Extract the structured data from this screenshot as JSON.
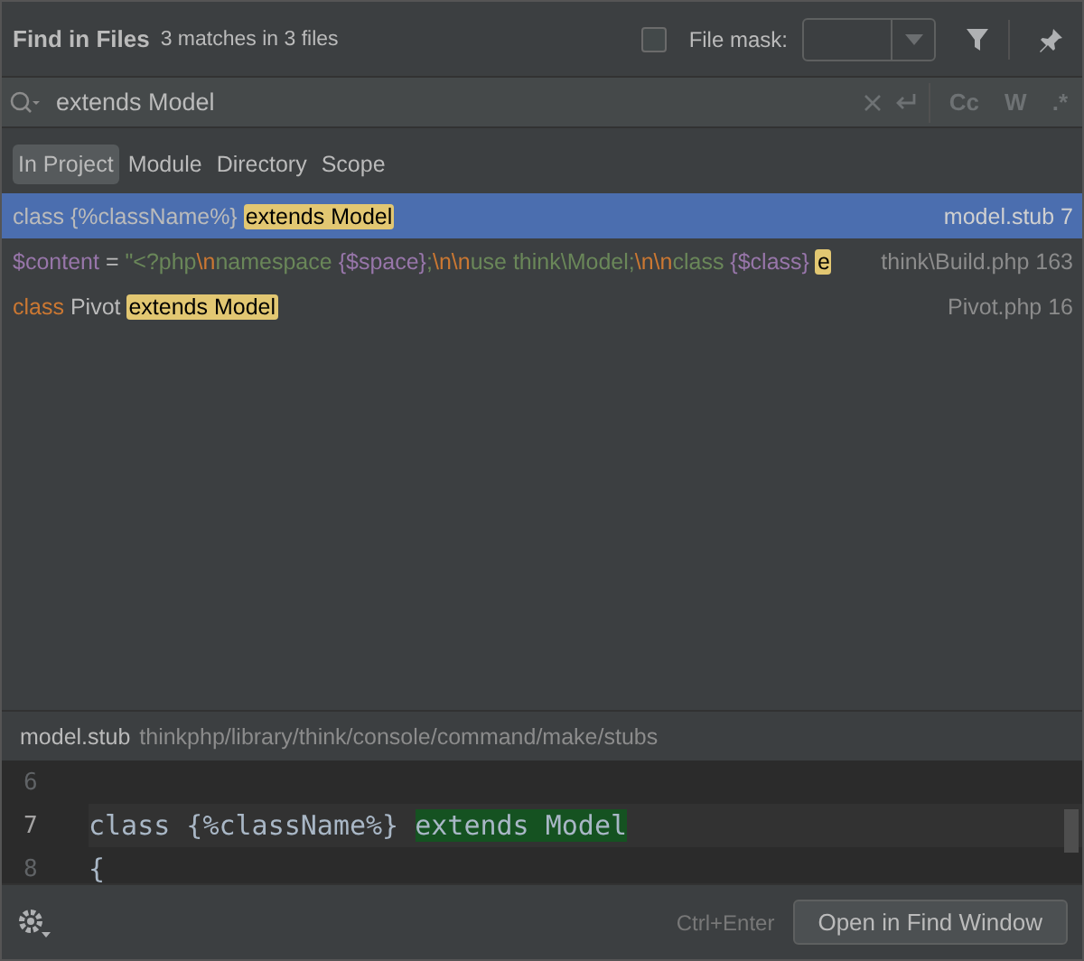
{
  "header": {
    "title": "Find in Files",
    "summary": "3 matches in 3 files",
    "file_mask": {
      "label": "File mask:",
      "checked": false
    }
  },
  "search": {
    "value": "extends Model",
    "options": [
      "Cc",
      "W",
      ".*"
    ]
  },
  "scopes": [
    {
      "label": "In Project",
      "selected": true
    },
    {
      "label": "Module",
      "selected": false
    },
    {
      "label": "Directory",
      "selected": false
    },
    {
      "label": "Scope",
      "selected": false
    }
  ],
  "results": [
    {
      "selected": true,
      "file": "model.stub 7",
      "segments": [
        {
          "kind": "plain",
          "text": "class {%className%} "
        },
        {
          "kind": "match",
          "text": "extends Model"
        }
      ]
    },
    {
      "selected": false,
      "file": "think\\Build.php 163",
      "segments": [
        {
          "kind": "var",
          "text": "$content"
        },
        {
          "kind": "plain",
          "text": " = "
        },
        {
          "kind": "string",
          "text": "\"<?php"
        },
        {
          "kind": "escape",
          "text": "\\n"
        },
        {
          "kind": "string",
          "text": "namespace "
        },
        {
          "kind": "var",
          "text": "{$space}"
        },
        {
          "kind": "string",
          "text": ";"
        },
        {
          "kind": "escape",
          "text": "\\n\\n"
        },
        {
          "kind": "string",
          "text": "use think\\Model;"
        },
        {
          "kind": "escape",
          "text": "\\n\\n"
        },
        {
          "kind": "string",
          "text": "class "
        },
        {
          "kind": "var",
          "text": "{$class} "
        },
        {
          "kind": "match",
          "text": "e"
        }
      ]
    },
    {
      "selected": false,
      "file": "Pivot.php 16",
      "segments": [
        {
          "kind": "keyword",
          "text": "class "
        },
        {
          "kind": "plain",
          "text": "Pivot "
        },
        {
          "kind": "match",
          "text": "extends Model"
        }
      ]
    }
  ],
  "preview": {
    "file": "model.stub",
    "path": "thinkphp/library/think/console/command/make/stubs",
    "lines": [
      {
        "number": "6",
        "current": false
      },
      {
        "number": "7",
        "current": true,
        "segments": [
          {
            "kind": "plain",
            "text": "class {%className%} "
          },
          {
            "kind": "match",
            "text": "extends Model"
          }
        ]
      },
      {
        "number": "8",
        "current": false,
        "segments": [
          {
            "kind": "plain",
            "text": "{"
          }
        ]
      }
    ]
  },
  "footer": {
    "shortcut": "Ctrl+Enter",
    "button": "Open in Find Window"
  }
}
